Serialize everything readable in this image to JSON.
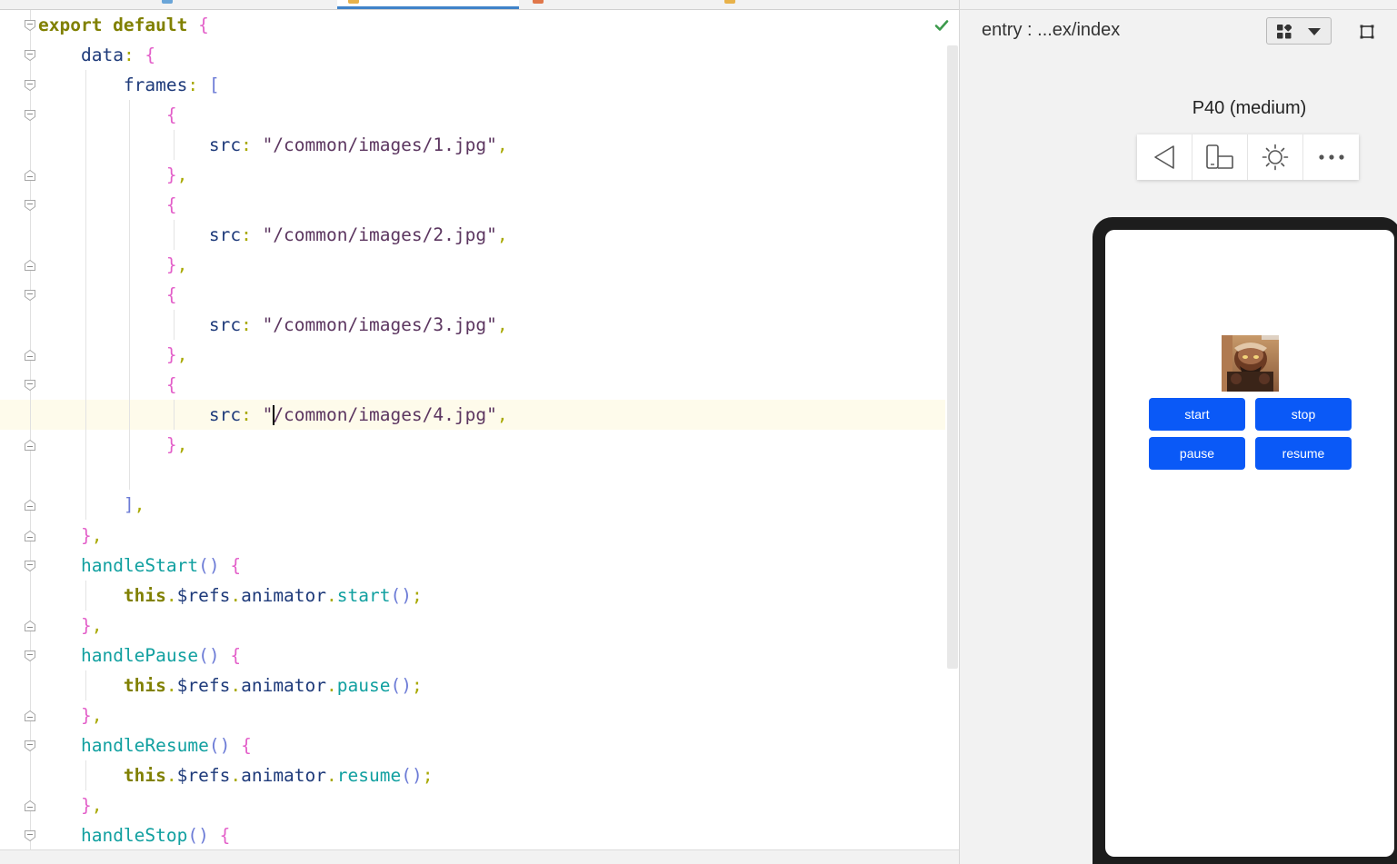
{
  "editor": {
    "lines": [
      {
        "tokens": [
          [
            "k",
            "export default "
          ],
          [
            "p",
            "{"
          ]
        ]
      },
      {
        "tokens": [
          [
            "",
            "    "
          ],
          [
            "prop",
            "data"
          ],
          [
            "punc",
            ": "
          ],
          [
            "p",
            "{"
          ]
        ]
      },
      {
        "tokens": [
          [
            "",
            "        "
          ],
          [
            "prop",
            "frames"
          ],
          [
            "punc",
            ": "
          ],
          [
            "pl",
            "["
          ]
        ]
      },
      {
        "tokens": [
          [
            "",
            "            "
          ],
          [
            "p",
            "{"
          ]
        ]
      },
      {
        "tokens": [
          [
            "",
            "                "
          ],
          [
            "prop",
            "src"
          ],
          [
            "punc",
            ": "
          ],
          [
            "s",
            "\"/common/images/1.jpg\""
          ],
          [
            "punc",
            ","
          ]
        ]
      },
      {
        "tokens": [
          [
            "",
            "            "
          ],
          [
            "p",
            "}"
          ],
          [
            "punc",
            ","
          ]
        ]
      },
      {
        "tokens": [
          [
            "",
            "            "
          ],
          [
            "p",
            "{"
          ]
        ]
      },
      {
        "tokens": [
          [
            "",
            "                "
          ],
          [
            "prop",
            "src"
          ],
          [
            "punc",
            ": "
          ],
          [
            "s",
            "\"/common/images/2.jpg\""
          ],
          [
            "punc",
            ","
          ]
        ]
      },
      {
        "tokens": [
          [
            "",
            "            "
          ],
          [
            "p",
            "}"
          ],
          [
            "punc",
            ","
          ]
        ]
      },
      {
        "tokens": [
          [
            "",
            "            "
          ],
          [
            "p",
            "{"
          ]
        ]
      },
      {
        "tokens": [
          [
            "",
            "                "
          ],
          [
            "prop",
            "src"
          ],
          [
            "punc",
            ": "
          ],
          [
            "s",
            "\"/common/images/3.jpg\""
          ],
          [
            "punc",
            ","
          ]
        ]
      },
      {
        "tokens": [
          [
            "",
            "            "
          ],
          [
            "p",
            "}"
          ],
          [
            "punc",
            ","
          ]
        ]
      },
      {
        "tokens": [
          [
            "",
            "            "
          ],
          [
            "p",
            "{"
          ]
        ]
      },
      {
        "tokens": [
          [
            "",
            "                "
          ],
          [
            "prop",
            "src"
          ],
          [
            "punc",
            ": "
          ],
          [
            "s",
            "\""
          ],
          [
            "caret",
            ""
          ],
          [
            "s",
            "/common/images/4.jpg\""
          ],
          [
            "punc",
            ","
          ]
        ]
      },
      {
        "tokens": [
          [
            "",
            "            "
          ],
          [
            "p",
            "}"
          ],
          [
            "punc",
            ","
          ]
        ]
      },
      {
        "tokens": []
      },
      {
        "tokens": [
          [
            "",
            "        "
          ],
          [
            "pl",
            "]"
          ],
          [
            "punc",
            ","
          ]
        ]
      },
      {
        "tokens": [
          [
            "",
            "    "
          ],
          [
            "p",
            "}"
          ],
          [
            "punc",
            ","
          ]
        ]
      },
      {
        "tokens": [
          [
            "",
            "    "
          ],
          [
            "fn",
            "handleStart"
          ],
          [
            "pl",
            "()"
          ],
          [
            "punc",
            " "
          ],
          [
            "p",
            "{"
          ]
        ]
      },
      {
        "tokens": [
          [
            "",
            "        "
          ],
          [
            "thisk",
            "this"
          ],
          [
            "punc",
            "."
          ],
          [
            "prop",
            "$refs"
          ],
          [
            "punc",
            "."
          ],
          [
            "prop",
            "animator"
          ],
          [
            "punc",
            "."
          ],
          [
            "fn",
            "start"
          ],
          [
            "pl",
            "()"
          ],
          [
            "punc",
            ";"
          ]
        ]
      },
      {
        "tokens": [
          [
            "",
            "    "
          ],
          [
            "p",
            "}"
          ],
          [
            "punc",
            ","
          ]
        ]
      },
      {
        "tokens": [
          [
            "",
            "    "
          ],
          [
            "fn",
            "handlePause"
          ],
          [
            "pl",
            "()"
          ],
          [
            "punc",
            " "
          ],
          [
            "p",
            "{"
          ]
        ]
      },
      {
        "tokens": [
          [
            "",
            "        "
          ],
          [
            "thisk",
            "this"
          ],
          [
            "punc",
            "."
          ],
          [
            "prop",
            "$refs"
          ],
          [
            "punc",
            "."
          ],
          [
            "prop",
            "animator"
          ],
          [
            "punc",
            "."
          ],
          [
            "fn",
            "pause"
          ],
          [
            "pl",
            "()"
          ],
          [
            "punc",
            ";"
          ]
        ]
      },
      {
        "tokens": [
          [
            "",
            "    "
          ],
          [
            "p",
            "}"
          ],
          [
            "punc",
            ","
          ]
        ]
      },
      {
        "tokens": [
          [
            "",
            "    "
          ],
          [
            "fn",
            "handleResume"
          ],
          [
            "pl",
            "()"
          ],
          [
            "punc",
            " "
          ],
          [
            "p",
            "{"
          ]
        ]
      },
      {
        "tokens": [
          [
            "",
            "        "
          ],
          [
            "thisk",
            "this"
          ],
          [
            "punc",
            "."
          ],
          [
            "prop",
            "$refs"
          ],
          [
            "punc",
            "."
          ],
          [
            "prop",
            "animator"
          ],
          [
            "punc",
            "."
          ],
          [
            "fn",
            "resume"
          ],
          [
            "pl",
            "()"
          ],
          [
            "punc",
            ";"
          ]
        ]
      },
      {
        "tokens": [
          [
            "",
            "    "
          ],
          [
            "p",
            "}"
          ],
          [
            "punc",
            ","
          ]
        ]
      },
      {
        "tokens": [
          [
            "",
            "    "
          ],
          [
            "fn",
            "handleStop"
          ],
          [
            "pl",
            "()"
          ],
          [
            "punc",
            " "
          ],
          [
            "p",
            "{"
          ]
        ]
      }
    ],
    "caret_line": 14
  },
  "preview": {
    "title": "entry : ...ex/index",
    "device_label": "P40 (medium)",
    "toolbar": [
      "back-icon",
      "rotate-device-icon",
      "theme-icon",
      "more-icon"
    ],
    "buttons": {
      "start": "start",
      "stop": "stop",
      "pause": "pause",
      "resume": "resume"
    }
  },
  "colors": {
    "accent": "#0a59f7",
    "caret_line_bg": "#fefbeb",
    "ok_check": "#3c9a4c"
  }
}
